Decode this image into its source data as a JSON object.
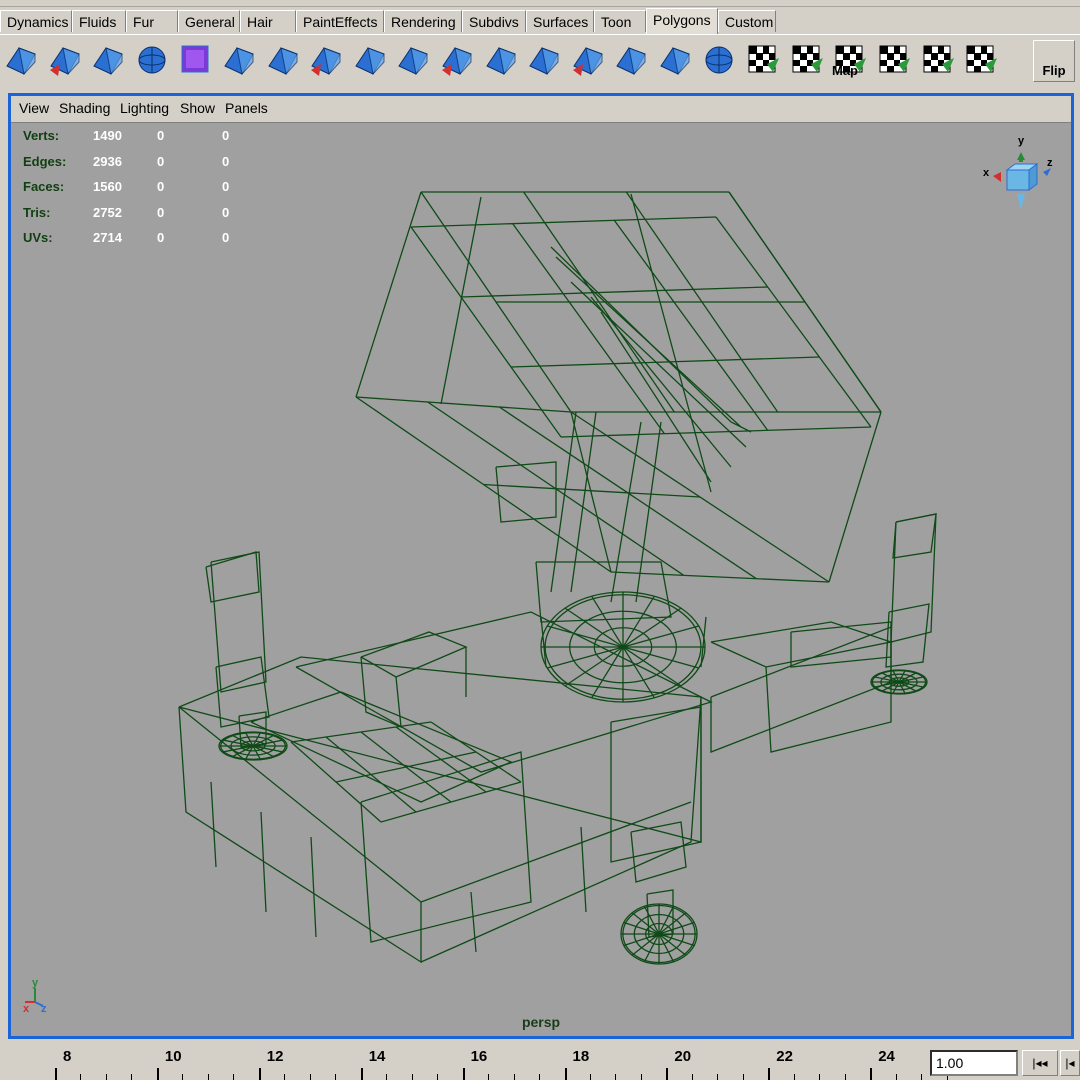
{
  "shelf_tabs": [
    {
      "label": "Dynamics",
      "active": false
    },
    {
      "label": "Fluids",
      "active": false
    },
    {
      "label": "Fur",
      "active": false
    },
    {
      "label": "General",
      "active": false
    },
    {
      "label": "Hair",
      "active": false
    },
    {
      "label": "PaintEffects",
      "active": false
    },
    {
      "label": "Rendering",
      "active": false
    },
    {
      "label": "Subdivs",
      "active": false
    },
    {
      "label": "Surfaces",
      "active": false
    },
    {
      "label": "Toon",
      "active": false
    },
    {
      "label": "Polygons",
      "active": true
    },
    {
      "label": "Custom",
      "active": false
    }
  ],
  "shelf_icons": [
    "poly-sphere-cube-icon",
    "combine-icon",
    "separate-icon",
    "smooth-sphere-icon",
    "reduce-cube-icon",
    "triangulate-icon",
    "select-face-icon",
    "extrude-face-icon",
    "extrude-edge-icon",
    "split-polygon-icon",
    "bevel-icon",
    "merge-icon",
    "subdivide-icon",
    "wedge-icon",
    "duplicate-face-icon",
    "extract-icon",
    "append-polygon-icon",
    "map-uv-icon",
    "planar-map-icon",
    "cylindrical-map-icon",
    "spherical-map-icon",
    "auto-map-icon",
    "uv-editor-icon"
  ],
  "shelf_flip_label": "Flip",
  "shelf_map_label": "Map",
  "panel_menu": [
    "View",
    "Shading",
    "Lighting",
    "Show",
    "Panels"
  ],
  "hud_stats": [
    {
      "label": "Verts:",
      "value": "1490",
      "sel": "0",
      "comp": "0"
    },
    {
      "label": "Edges:",
      "value": "2936",
      "sel": "0",
      "comp": "0"
    },
    {
      "label": "Faces:",
      "value": "1560",
      "sel": "0",
      "comp": "0"
    },
    {
      "label": "Tris:",
      "value": "2752",
      "sel": "0",
      "comp": "0"
    },
    {
      "label": "UVs:",
      "value": "2714",
      "sel": "0",
      "comp": "0"
    }
  ],
  "view_cube": {
    "x": "x",
    "y": "y",
    "z": "z"
  },
  "axis_indicator": {
    "x": "x",
    "y": "y",
    "z": "z"
  },
  "camera_label": "persp",
  "timeline": {
    "ticks": [
      "8",
      "10",
      "12",
      "14",
      "16",
      "18",
      "20",
      "22",
      "24"
    ],
    "current_frame": "1.00",
    "rewind_label": "|◂◂",
    "step_back_label": "|◂"
  },
  "colors": {
    "wireframe": "#0f4a17",
    "viewport_bg": "#a0a0a0",
    "active_panel_border": "#1b63d9",
    "ui_gray": "#d4d0c8",
    "icon_blue": "#2a6fd1"
  }
}
